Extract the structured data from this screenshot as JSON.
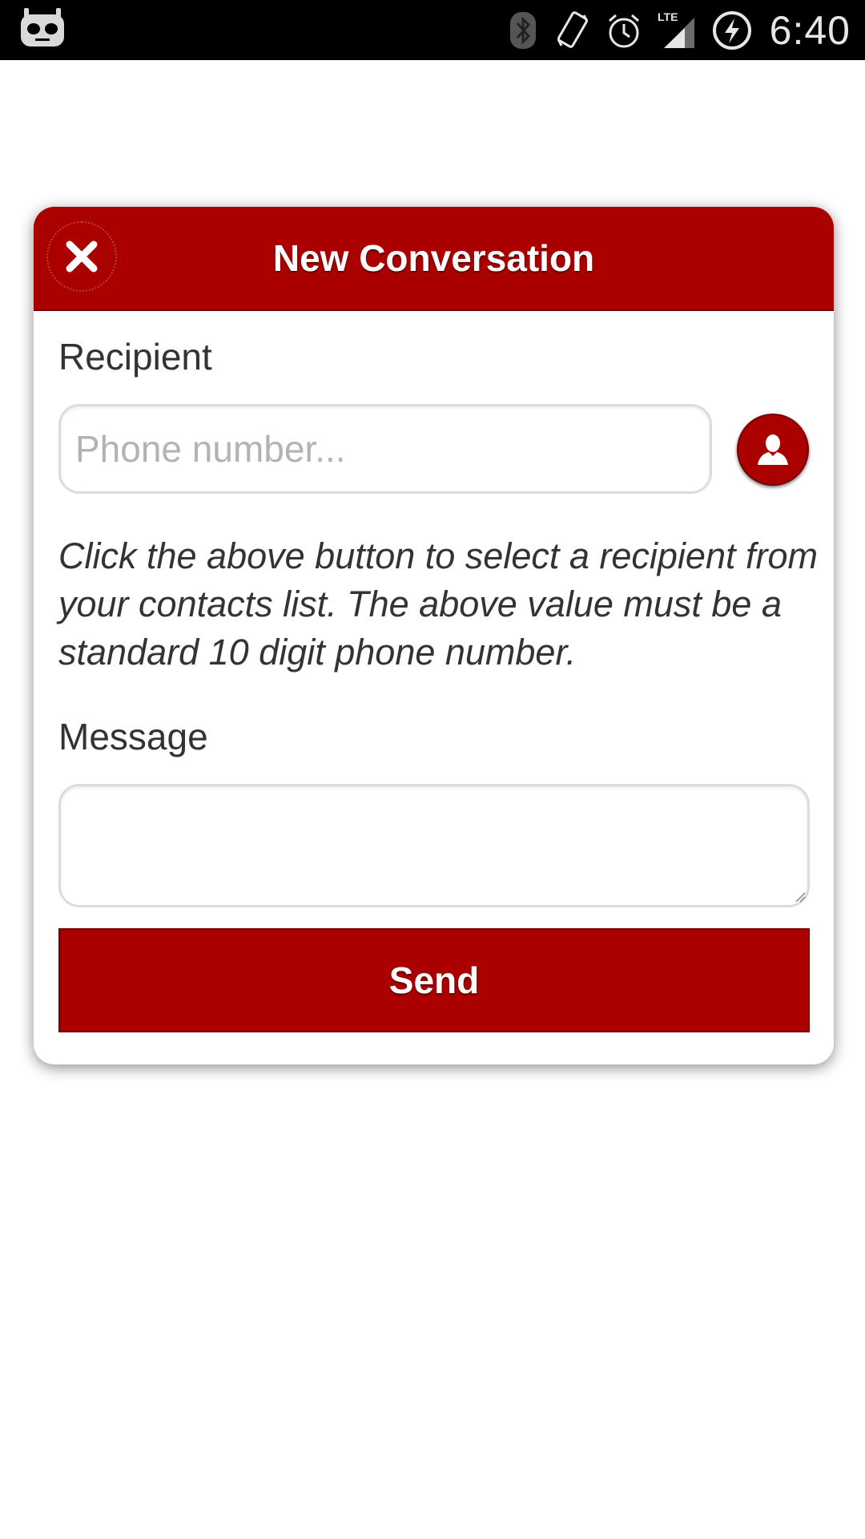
{
  "status_bar": {
    "time": "6:40",
    "icons": [
      "cyanogenmod-icon",
      "bluetooth-icon",
      "vibrate-icon",
      "alarm-icon",
      "lte-signal-icon",
      "battery-charging-icon"
    ],
    "network_label": "LTE"
  },
  "dialog": {
    "title": "New Conversation",
    "close_icon": "close-icon",
    "recipient": {
      "label": "Recipient",
      "value": "",
      "placeholder": "Phone number...",
      "contact_icon": "contact-person-icon"
    },
    "help_text": "Click the above button to select a recipient from your contacts list. The above value must be a standard 10 digit phone number.",
    "message": {
      "label": "Message",
      "value": ""
    },
    "send_label": "Send"
  },
  "colors": {
    "accent": "#aa0000",
    "accent_dark": "#7a0000",
    "status_bar": "#000000",
    "text": "#333333",
    "placeholder": "#b3b3b3"
  }
}
